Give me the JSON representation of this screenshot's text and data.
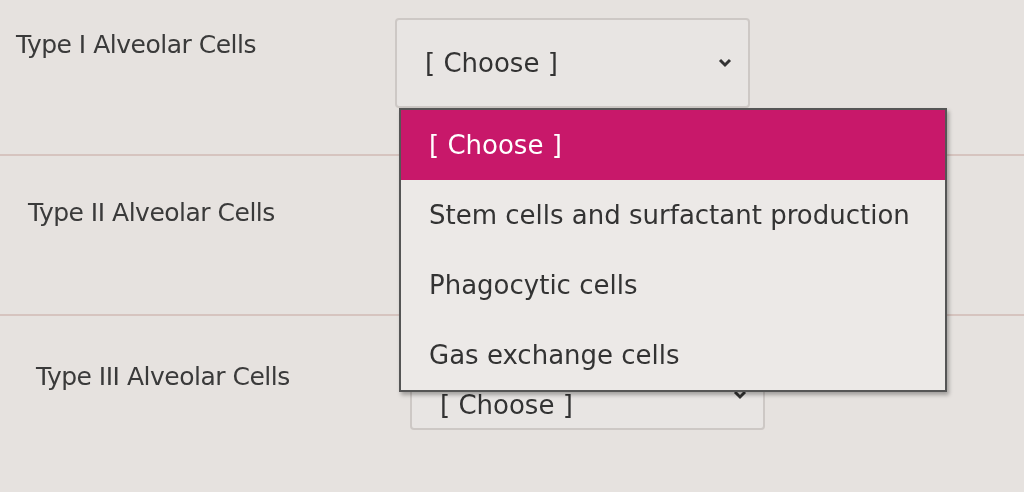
{
  "rows": [
    {
      "label": "Type I Alveolar Cells",
      "select": {
        "value": "[ Choose ]",
        "open": true
      }
    },
    {
      "label": "Type II Alveolar Cells"
    },
    {
      "label": "Type III Alveolar Cells",
      "select": {
        "value": "[ Choose ]",
        "open": false
      }
    }
  ],
  "dropdown": {
    "options": [
      {
        "label": "[ Choose ]",
        "selected": true
      },
      {
        "label": "Stem cells and surfactant production",
        "selected": false
      },
      {
        "label": "Phagocytic cells",
        "selected": false
      },
      {
        "label": "Gas exchange cells",
        "selected": false
      }
    ]
  }
}
